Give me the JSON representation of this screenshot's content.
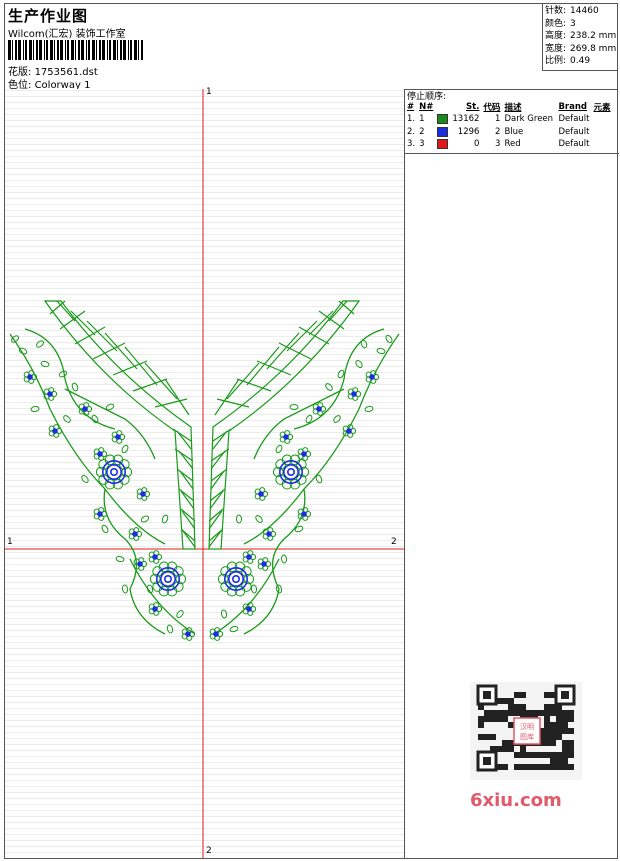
{
  "header": {
    "title": "生产作业图",
    "company": "Wilcom(汇宏) 装饰工作室",
    "design_label": "花版:",
    "design_value": "1753561.dst",
    "colorway_label": "色位:",
    "colorway_value": "Colorway 1"
  },
  "stats": [
    {
      "label": "针数:",
      "value": "14460"
    },
    {
      "label": "颜色:",
      "value": "3"
    },
    {
      "label": "高度:",
      "value": "238.2 mm"
    },
    {
      "label": "宽度:",
      "value": "269.8 mm"
    },
    {
      "label": "比例:",
      "value": "0.49"
    }
  ],
  "stop_sequence": {
    "title": "停止顺序:",
    "columns": [
      "#",
      "N#",
      "St.",
      "代码",
      "描述",
      "Brand",
      "元素"
    ],
    "rows": [
      {
        "idx": "1.",
        "n": "1",
        "st": "13162",
        "code": "1",
        "desc": "Dark Green",
        "brand": "Default",
        "color": "#1a8a1a"
      },
      {
        "idx": "2.",
        "n": "2",
        "st": "1296",
        "code": "2",
        "desc": "Blue",
        "brand": "Default",
        "color": "#1a2ee0"
      },
      {
        "idx": "3.",
        "n": "3",
        "st": "0",
        "code": "3",
        "desc": "Red",
        "brand": "Default",
        "color": "#e01a1a"
      }
    ]
  },
  "axes": {
    "top": "1",
    "left": "1",
    "right": "2",
    "bottom": "2"
  },
  "watermark": {
    "stamp": "汉明图库",
    "site": "6xiu.com"
  },
  "colors": {
    "green": "#1a9a1a",
    "blue": "#1a2ee0",
    "red": "#e01a1a"
  }
}
